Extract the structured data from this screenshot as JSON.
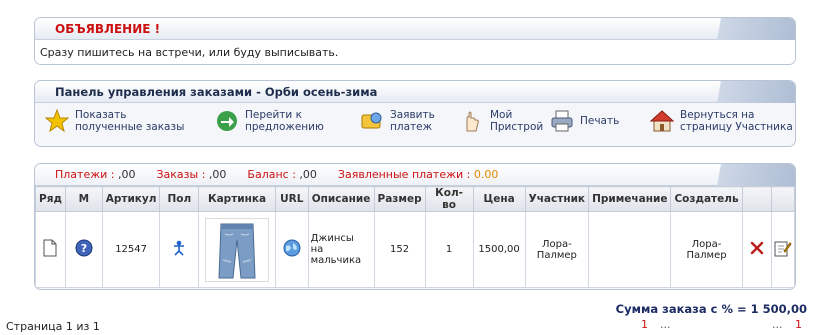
{
  "announcement": {
    "title": "ОБЪЯВЛЕНИЕ !",
    "text": "Сразу пишитесь на встречи, или буду выписывать."
  },
  "control_panel": {
    "title": "Панель управления заказами - Орби осень-зима",
    "items": [
      {
        "label_1": "Показать",
        "label_2": "полученные заказы",
        "icon": "star-icon"
      },
      {
        "label_1": "Перейти к",
        "label_2": "предложению",
        "icon": "arrow-icon"
      },
      {
        "label_1": "Заявить",
        "label_2": "платеж",
        "icon": "payment-icon"
      },
      {
        "label_1": "Мой",
        "label_2": "Пристрой",
        "icon": "hand-icon"
      },
      {
        "label_1": "Печать",
        "label_2": "",
        "icon": "printer-icon"
      },
      {
        "label_1": "Вернуться на",
        "label_2": "страницу Участника",
        "icon": "home-icon"
      }
    ]
  },
  "stats": {
    "payments_label": "Платежи :",
    "payments_value": ",00",
    "orders_label": "Заказы :",
    "orders_value": ",00",
    "balance_label": "Баланс :",
    "balance_value": ",00",
    "declared_label": "Заявленные платежи :",
    "declared_value": "0.00"
  },
  "table": {
    "columns": [
      "Ряд",
      "М",
      "Артикул",
      "Пол",
      "Картинка",
      "URL",
      "Описание",
      "Размер",
      "Кол-во",
      "Цена",
      "Участник",
      "Примечание",
      "Создатель",
      "",
      ""
    ],
    "rows": [
      {
        "article": "12547",
        "description_1": "Джинсы",
        "description_2": "на",
        "description_3": "мальчика",
        "size": "152",
        "qty": "1",
        "price": "1500,00",
        "participant_1": "Лора-",
        "participant_2": "Палмер",
        "note": "",
        "creator_1": "Лора-",
        "creator_2": "Палмер"
      }
    ]
  },
  "summary": {
    "total": "Сумма заказа с % = 1 500,00"
  },
  "pager": {
    "page_text": "Страница 1 из 1",
    "first": "1",
    "dots_1": "...",
    "dots_2": "...",
    "last": "1"
  },
  "colors": {
    "accent_red": "#cc1111",
    "title_navy": "#1f2d4d",
    "border": "#b9c4d6"
  }
}
